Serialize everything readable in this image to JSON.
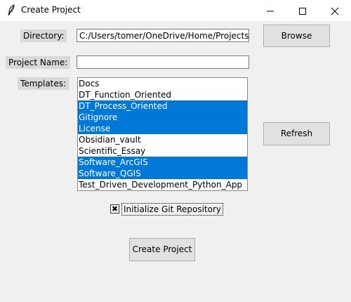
{
  "window": {
    "title": "Create Project",
    "controls": {
      "minimize": "—",
      "maximize": "☐",
      "close": "✕"
    }
  },
  "form": {
    "directory_label": "Directory:",
    "directory_value": "C:/Users/tomer/OneDrive/Home/Projects",
    "project_name_label": "Project Name:",
    "project_name_value": "",
    "templates_label": "Templates:"
  },
  "templates": [
    {
      "label": "Docs",
      "selected": false
    },
    {
      "label": "DT_Function_Oriented",
      "selected": false
    },
    {
      "label": "DT_Process_Oriented",
      "selected": true
    },
    {
      "label": "Gitignore",
      "selected": true
    },
    {
      "label": "License",
      "selected": true
    },
    {
      "label": "Obsidian_vault",
      "selected": false
    },
    {
      "label": "Scientific_Essay",
      "selected": false
    },
    {
      "label": "Software_ArcGIS",
      "selected": true
    },
    {
      "label": "Software_QGIS",
      "selected": true
    },
    {
      "label": "Test_Driven_Development_Python_App",
      "selected": false
    }
  ],
  "buttons": {
    "browse": "Browse",
    "refresh": "Refresh",
    "create_project": "Create Project"
  },
  "git": {
    "label": "Initialize Git Repository",
    "checked": true,
    "check_mark": "✖"
  },
  "colors": {
    "selection": "#0078d7",
    "label_bg": "#d9d9d9",
    "window_bg": "#f0f0f0"
  }
}
